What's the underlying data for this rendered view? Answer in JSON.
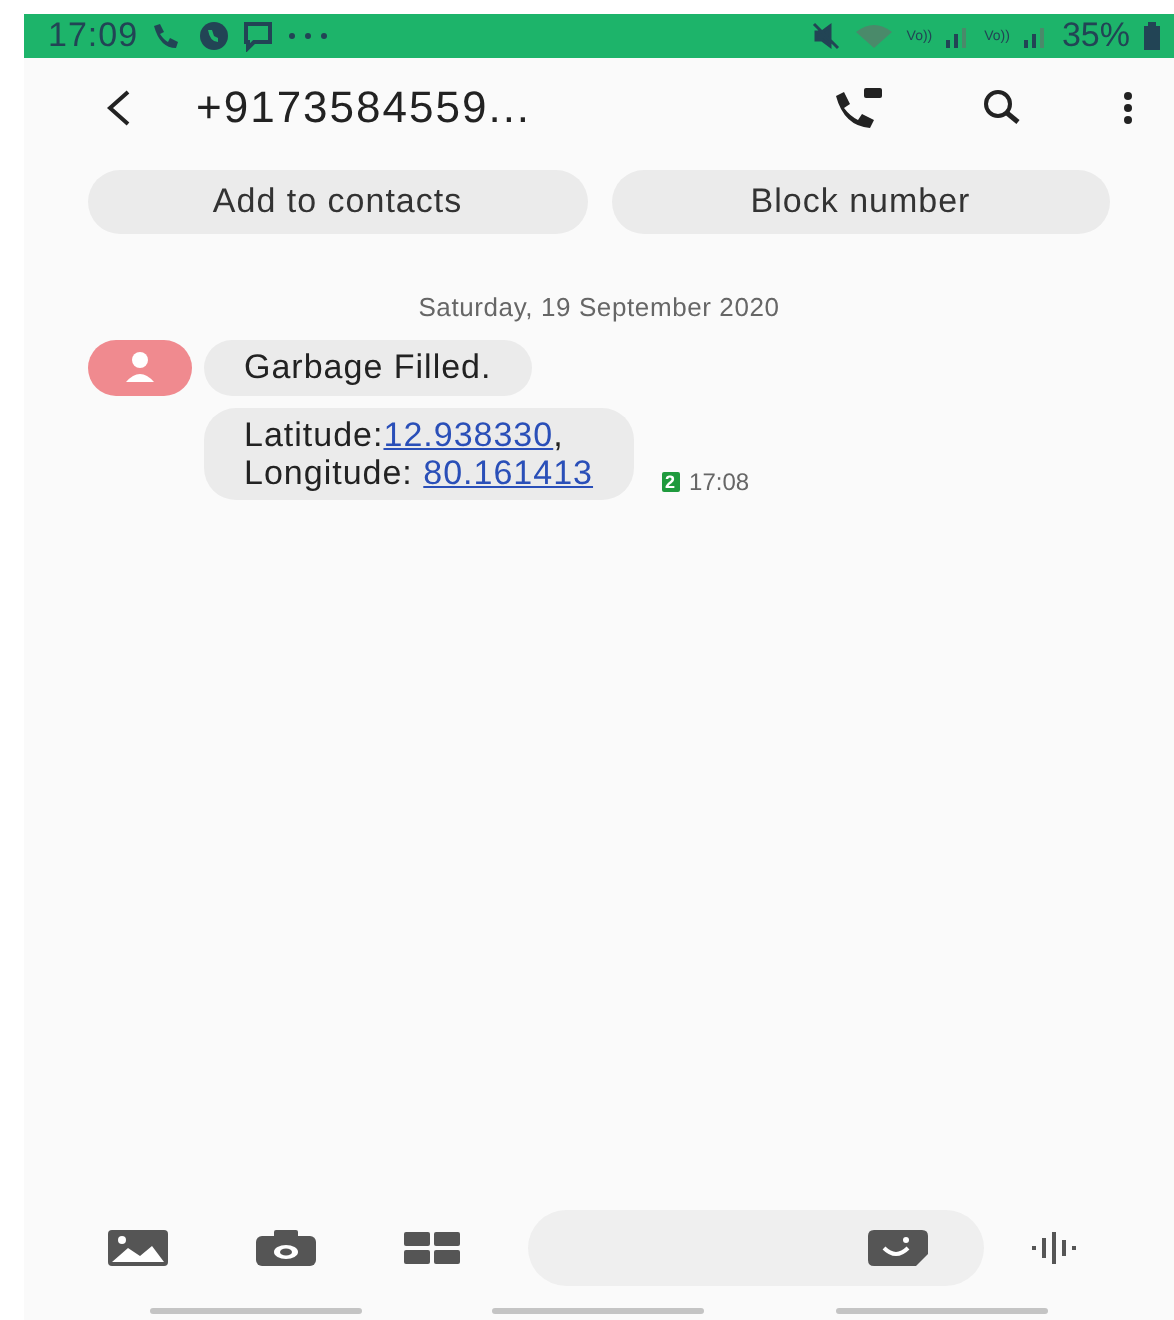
{
  "status_bar": {
    "time": "17:09",
    "network_1": "Vo))",
    "network_2": "Vo))",
    "battery": "35%"
  },
  "header": {
    "title": "+9173584559..."
  },
  "actions": [
    "Add to contacts",
    "Block number"
  ],
  "date": "Saturday, 19 September 2020",
  "messages": [
    {
      "kind": "plain",
      "text": "Garbage Filled."
    },
    {
      "kind": "coords",
      "lines": [
        {
          "label": "Latitude:",
          "link": "12.938330",
          "suffix": ","
        },
        {
          "label": "Longitude: ",
          "link": "80.161413"
        }
      ]
    }
  ],
  "sim_badge": "2",
  "timestamp": "17:08"
}
